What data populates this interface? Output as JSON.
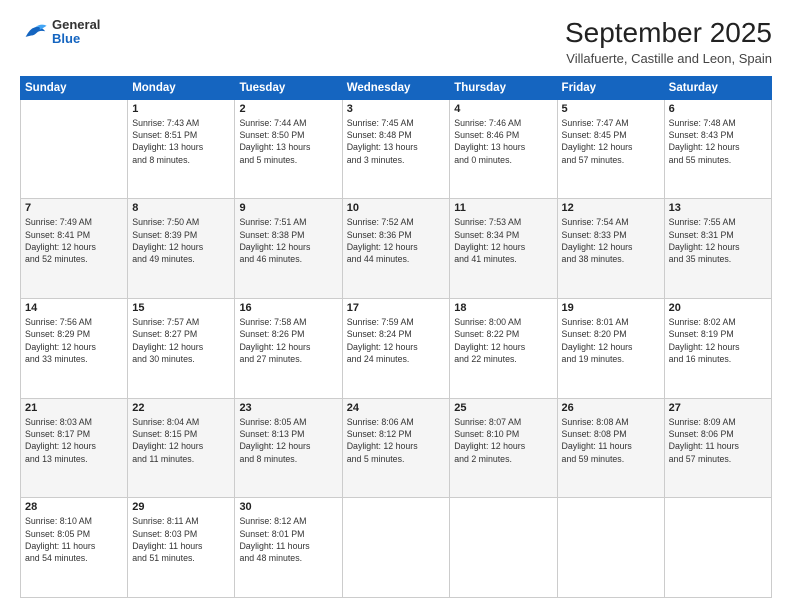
{
  "logo": {
    "general": "General",
    "blue": "Blue"
  },
  "header": {
    "month": "September 2025",
    "location": "Villafuerte, Castille and Leon, Spain"
  },
  "weekdays": [
    "Sunday",
    "Monday",
    "Tuesday",
    "Wednesday",
    "Thursday",
    "Friday",
    "Saturday"
  ],
  "weeks": [
    [
      {
        "day": "",
        "info": ""
      },
      {
        "day": "1",
        "info": "Sunrise: 7:43 AM\nSunset: 8:51 PM\nDaylight: 13 hours\nand 8 minutes."
      },
      {
        "day": "2",
        "info": "Sunrise: 7:44 AM\nSunset: 8:50 PM\nDaylight: 13 hours\nand 5 minutes."
      },
      {
        "day": "3",
        "info": "Sunrise: 7:45 AM\nSunset: 8:48 PM\nDaylight: 13 hours\nand 3 minutes."
      },
      {
        "day": "4",
        "info": "Sunrise: 7:46 AM\nSunset: 8:46 PM\nDaylight: 13 hours\nand 0 minutes."
      },
      {
        "day": "5",
        "info": "Sunrise: 7:47 AM\nSunset: 8:45 PM\nDaylight: 12 hours\nand 57 minutes."
      },
      {
        "day": "6",
        "info": "Sunrise: 7:48 AM\nSunset: 8:43 PM\nDaylight: 12 hours\nand 55 minutes."
      }
    ],
    [
      {
        "day": "7",
        "info": "Sunrise: 7:49 AM\nSunset: 8:41 PM\nDaylight: 12 hours\nand 52 minutes."
      },
      {
        "day": "8",
        "info": "Sunrise: 7:50 AM\nSunset: 8:39 PM\nDaylight: 12 hours\nand 49 minutes."
      },
      {
        "day": "9",
        "info": "Sunrise: 7:51 AM\nSunset: 8:38 PM\nDaylight: 12 hours\nand 46 minutes."
      },
      {
        "day": "10",
        "info": "Sunrise: 7:52 AM\nSunset: 8:36 PM\nDaylight: 12 hours\nand 44 minutes."
      },
      {
        "day": "11",
        "info": "Sunrise: 7:53 AM\nSunset: 8:34 PM\nDaylight: 12 hours\nand 41 minutes."
      },
      {
        "day": "12",
        "info": "Sunrise: 7:54 AM\nSunset: 8:33 PM\nDaylight: 12 hours\nand 38 minutes."
      },
      {
        "day": "13",
        "info": "Sunrise: 7:55 AM\nSunset: 8:31 PM\nDaylight: 12 hours\nand 35 minutes."
      }
    ],
    [
      {
        "day": "14",
        "info": "Sunrise: 7:56 AM\nSunset: 8:29 PM\nDaylight: 12 hours\nand 33 minutes."
      },
      {
        "day": "15",
        "info": "Sunrise: 7:57 AM\nSunset: 8:27 PM\nDaylight: 12 hours\nand 30 minutes."
      },
      {
        "day": "16",
        "info": "Sunrise: 7:58 AM\nSunset: 8:26 PM\nDaylight: 12 hours\nand 27 minutes."
      },
      {
        "day": "17",
        "info": "Sunrise: 7:59 AM\nSunset: 8:24 PM\nDaylight: 12 hours\nand 24 minutes."
      },
      {
        "day": "18",
        "info": "Sunrise: 8:00 AM\nSunset: 8:22 PM\nDaylight: 12 hours\nand 22 minutes."
      },
      {
        "day": "19",
        "info": "Sunrise: 8:01 AM\nSunset: 8:20 PM\nDaylight: 12 hours\nand 19 minutes."
      },
      {
        "day": "20",
        "info": "Sunrise: 8:02 AM\nSunset: 8:19 PM\nDaylight: 12 hours\nand 16 minutes."
      }
    ],
    [
      {
        "day": "21",
        "info": "Sunrise: 8:03 AM\nSunset: 8:17 PM\nDaylight: 12 hours\nand 13 minutes."
      },
      {
        "day": "22",
        "info": "Sunrise: 8:04 AM\nSunset: 8:15 PM\nDaylight: 12 hours\nand 11 minutes."
      },
      {
        "day": "23",
        "info": "Sunrise: 8:05 AM\nSunset: 8:13 PM\nDaylight: 12 hours\nand 8 minutes."
      },
      {
        "day": "24",
        "info": "Sunrise: 8:06 AM\nSunset: 8:12 PM\nDaylight: 12 hours\nand 5 minutes."
      },
      {
        "day": "25",
        "info": "Sunrise: 8:07 AM\nSunset: 8:10 PM\nDaylight: 12 hours\nand 2 minutes."
      },
      {
        "day": "26",
        "info": "Sunrise: 8:08 AM\nSunset: 8:08 PM\nDaylight: 11 hours\nand 59 minutes."
      },
      {
        "day": "27",
        "info": "Sunrise: 8:09 AM\nSunset: 8:06 PM\nDaylight: 11 hours\nand 57 minutes."
      }
    ],
    [
      {
        "day": "28",
        "info": "Sunrise: 8:10 AM\nSunset: 8:05 PM\nDaylight: 11 hours\nand 54 minutes."
      },
      {
        "day": "29",
        "info": "Sunrise: 8:11 AM\nSunset: 8:03 PM\nDaylight: 11 hours\nand 51 minutes."
      },
      {
        "day": "30",
        "info": "Sunrise: 8:12 AM\nSunset: 8:01 PM\nDaylight: 11 hours\nand 48 minutes."
      },
      {
        "day": "",
        "info": ""
      },
      {
        "day": "",
        "info": ""
      },
      {
        "day": "",
        "info": ""
      },
      {
        "day": "",
        "info": ""
      }
    ]
  ]
}
